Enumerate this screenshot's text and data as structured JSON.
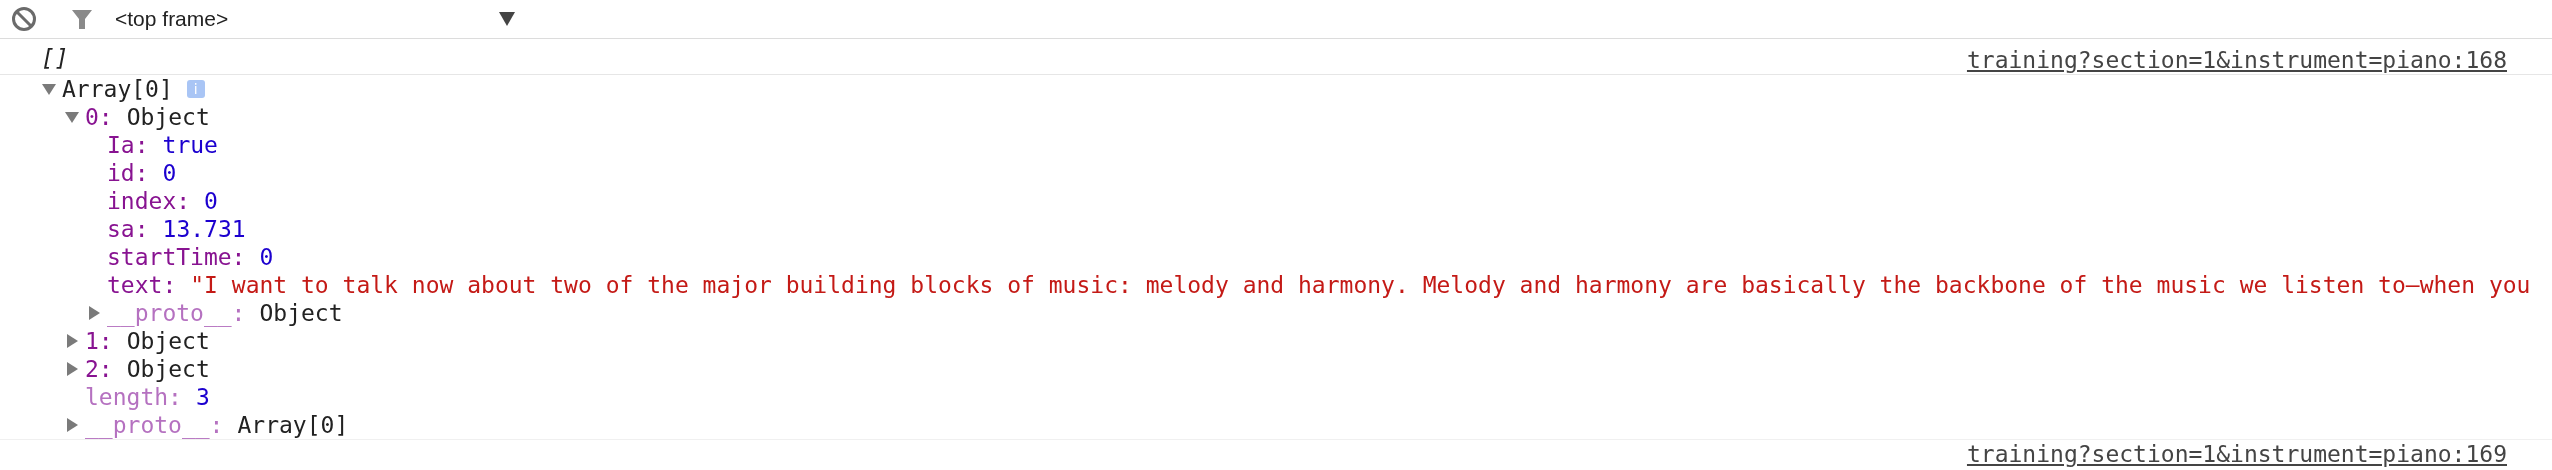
{
  "toolbar": {
    "frame_selector": {
      "value": "<top frame>"
    }
  },
  "messages": [
    {
      "summary": "[]",
      "source": "training?section=1&instrument=piano:168",
      "tree": [
        {
          "key": "Array[0]",
          "badge": "i",
          "expanded": true,
          "children": [
            {
              "key": "0:",
              "value": "Object",
              "kind": "object",
              "expanded": true,
              "children": [
                {
                  "key": "Ia:",
                  "value": "true",
                  "kind": "boolean"
                },
                {
                  "key": "id:",
                  "value": "0",
                  "kind": "number"
                },
                {
                  "key": "index:",
                  "value": "0",
                  "kind": "number"
                },
                {
                  "key": "sa:",
                  "value": "13.731",
                  "kind": "number"
                },
                {
                  "key": "startTime:",
                  "value": "0",
                  "kind": "number"
                },
                {
                  "key": "text:",
                  "value": "\"I want to talk now about two of the major building blocks of music: melody and harmony. Melody and harmony are basically the backbone of the music we listen to—when you",
                  "kind": "string"
                },
                {
                  "key": "__proto__:",
                  "value": "Object",
                  "kind": "object",
                  "expanded": false,
                  "internal": true
                }
              ]
            },
            {
              "key": "1:",
              "value": "Object",
              "kind": "object",
              "expanded": false
            },
            {
              "key": "2:",
              "value": "Object",
              "kind": "object",
              "expanded": false
            },
            {
              "key": "length:",
              "value": "3",
              "kind": "number",
              "internal": true
            },
            {
              "key": "__proto__:",
              "value": "Array[0]",
              "kind": "object",
              "expanded": false,
              "internal": true
            }
          ]
        }
      ]
    },
    {
      "source": "training?section=1&instrument=piano:169"
    }
  ]
}
